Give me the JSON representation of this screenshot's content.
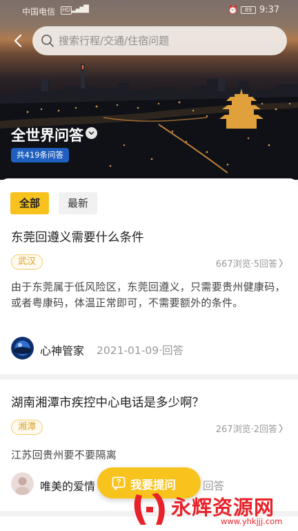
{
  "status_bar": {
    "carrier": "中国电信",
    "hd": "HD",
    "signal": "▂▄▆█",
    "battery": "89",
    "time": "9:37"
  },
  "search": {
    "placeholder": "搜索行程/交通/住宿问题"
  },
  "hero": {
    "title": "全世界问答",
    "count": "共419条问答"
  },
  "tabs": [
    {
      "label": "全部",
      "active": true
    },
    {
      "label": "最新",
      "active": false
    }
  ],
  "questions": [
    {
      "title": "东莞回遵义需要什么条件",
      "city": "武汉",
      "stats": "667浏览·5回答",
      "answer": "由于东莞属于低风险区，东莞回遵义，只需要贵州健康码，或者粤康码，体温正常即可，不需要额外的条件。",
      "author": "心神管家",
      "meta": "2021-01-09·回答"
    },
    {
      "title": "湖南湘潭市疾控中心电话是多少啊？",
      "city": "湘潭",
      "stats": "267浏览·2回答",
      "answer": "江苏回贵州要不要隔离",
      "author": "唯美的爱情",
      "meta": "回答"
    }
  ],
  "fab": {
    "label": "我要提问"
  },
  "watermark": {
    "text": "永辉资源网",
    "url": "www.yhkjjj.com"
  },
  "colors": {
    "accent": "#f7c21d",
    "tag_text": "#d9a32a",
    "hero_badge": "#1f5fbf",
    "watermark": "#e8222a"
  }
}
